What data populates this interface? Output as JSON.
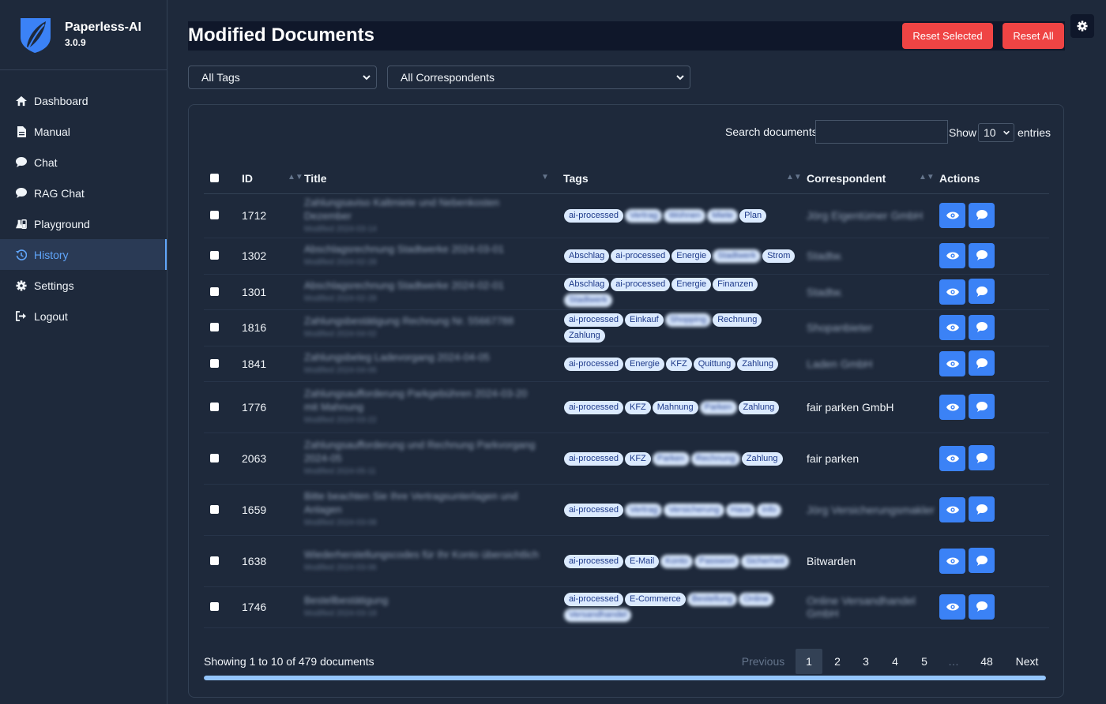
{
  "app": {
    "name": "Paperless-AI",
    "version": "3.0.9"
  },
  "sidebar": {
    "items": [
      {
        "label": "Dashboard",
        "icon": "home-icon"
      },
      {
        "label": "Manual",
        "icon": "file-icon"
      },
      {
        "label": "Chat",
        "icon": "chat-icon"
      },
      {
        "label": "RAG Chat",
        "icon": "chat-icon"
      },
      {
        "label": "Playground",
        "icon": "flask-icon"
      },
      {
        "label": "History",
        "icon": "history-icon",
        "active": true
      },
      {
        "label": "Settings",
        "icon": "gear-icon"
      },
      {
        "label": "Logout",
        "icon": "logout-icon"
      }
    ]
  },
  "page": {
    "title": "Modified Documents",
    "reset_selected": "Reset Selected",
    "reset_all": "Reset All"
  },
  "filters": {
    "tags": "All Tags",
    "correspondents": "All Correspondents"
  },
  "search": {
    "label": "Search documents:",
    "value": ""
  },
  "entries": {
    "show": "Show",
    "value": "10",
    "suffix": "entries"
  },
  "table": {
    "headers": {
      "id": "ID",
      "title": "Title",
      "tags": "Tags",
      "correspondent": "Correspondent",
      "actions": "Actions"
    },
    "rows": [
      {
        "id": "1712",
        "title": "Zahlungsaviso Kaltmiete und Nebenkosten Dezember",
        "meta": "Modified 2024-03-14",
        "tags": [
          "ai-processed",
          "Vertrag",
          "Wohnen",
          "Miete",
          "Plan"
        ],
        "tag_blur": [
          false,
          true,
          true,
          true,
          false
        ],
        "correspondent": "Jörg Eigentümer GmbH",
        "corr_blur": true,
        "h": 56
      },
      {
        "id": "1302",
        "title": "Abschlagsrechnung Stadtwerke 2024-03-01",
        "meta": "Modified 2024-02-28",
        "tags": [
          "Abschlag",
          "ai-processed",
          "Energie",
          "Stadtwerk",
          "Strom"
        ],
        "tag_blur": [
          false,
          false,
          false,
          true,
          false
        ],
        "correspondent": "Stadtw.",
        "corr_blur": true,
        "h": 46
      },
      {
        "id": "1301",
        "title": "Abschlagsrechnung Stadtwerke 2024-02-01",
        "meta": "Modified 2024-02-28",
        "tags": [
          "Abschlag",
          "ai-processed",
          "Energie",
          "Finanzen",
          "Stadtwerk"
        ],
        "tag_blur": [
          false,
          false,
          false,
          false,
          true
        ],
        "correspondent": "Stadtw.",
        "corr_blur": true,
        "h": 45
      },
      {
        "id": "1816",
        "title": "Zahlungsbestätigung Rechnung Nr. 55667788",
        "meta": "Modified 2024-04-02",
        "tags": [
          "ai-processed",
          "Einkauf",
          "Shopping",
          "Rechnung",
          "Zahlung"
        ],
        "tag_blur": [
          false,
          false,
          true,
          false,
          false
        ],
        "correspondent": "Shopanbieter",
        "corr_blur": true,
        "h": 46
      },
      {
        "id": "1841",
        "title": "Zahlungsbeleg Ladevorgang 2024-04-05",
        "meta": "Modified 2024-04-06",
        "tags": [
          "ai-processed",
          "Energie",
          "KFZ",
          "Quittung",
          "Zahlung"
        ],
        "tag_blur": [
          false,
          false,
          false,
          false,
          false
        ],
        "correspondent": "Laden GmbH",
        "corr_blur": true,
        "h": 45
      },
      {
        "id": "1776",
        "title": "Zahlungsaufforderung Parkgebühren 2024-03-20 mit Mahnung",
        "meta": "Modified 2024-03-22",
        "tags": [
          "ai-processed",
          "KFZ",
          "Mahnung",
          "Parken",
          "Zahlung"
        ],
        "tag_blur": [
          false,
          false,
          false,
          true,
          false
        ],
        "correspondent": "fair parken GmbH",
        "corr_blur": false,
        "h": 65
      },
      {
        "id": "2063",
        "title": "Zahlungsaufforderung und Rechnung Parkvorgang 2024-05",
        "meta": "Modified 2024-05-11",
        "tags": [
          "ai-processed",
          "KFZ",
          "Parken",
          "Rechnung",
          "Zahlung"
        ],
        "tag_blur": [
          false,
          false,
          true,
          true,
          false
        ],
        "correspondent": "fair parken",
        "corr_blur": false,
        "h": 65
      },
      {
        "id": "1659",
        "title": "Bitte beachten Sie Ihre Vertragsunterlagen und Anlagen",
        "meta": "Modified 2024-03-08",
        "tags": [
          "ai-processed",
          "Vertrag",
          "Versicherung",
          "Haus",
          "Info"
        ],
        "tag_blur": [
          false,
          true,
          true,
          true,
          true
        ],
        "correspondent": "Jörg Versicherungsmakler",
        "corr_blur": true,
        "h": 65
      },
      {
        "id": "1638",
        "title": "Wiederherstellungscodes für Ihr Konto übersichtlich",
        "meta": "Modified 2024-03-06",
        "tags": [
          "ai-processed",
          "E-Mail",
          "Konto",
          "Passwort",
          "Sicherheit"
        ],
        "tag_blur": [
          false,
          false,
          true,
          true,
          true
        ],
        "correspondent": "Bitwarden",
        "corr_blur": false,
        "h": 65
      },
      {
        "id": "1746",
        "title": "Bestellbestätigung",
        "meta": "Modified 2024-03-18",
        "tags": [
          "ai-processed",
          "E-Commerce",
          "Bestellung",
          "Online",
          "Versandhandel"
        ],
        "tag_blur": [
          false,
          false,
          true,
          true,
          true
        ],
        "correspondent": "Online Versandhandel GmbH",
        "corr_blur": true,
        "h": 52
      }
    ]
  },
  "footer": {
    "info": "Showing 1 to 10 of 479 documents",
    "pages": [
      "Previous",
      "1",
      "2",
      "3",
      "4",
      "5",
      "…",
      "48",
      "Next"
    ],
    "progress": 1.0
  },
  "colors": {
    "accent": "#3b82f6",
    "danger": "#ef4444",
    "bg": "#1e293b",
    "tag_bg": "#dbeafe"
  }
}
